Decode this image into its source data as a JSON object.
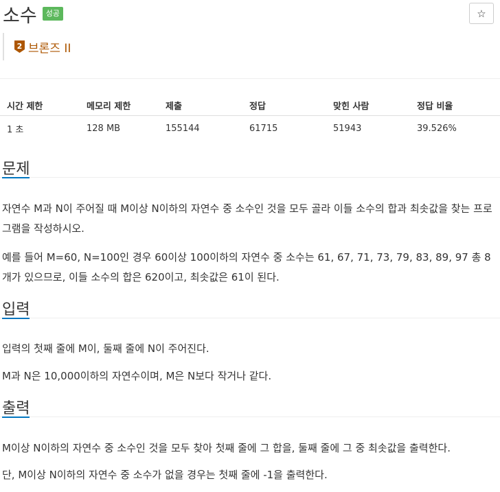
{
  "problem": {
    "title": "소수",
    "result_badge": "성공",
    "tier_number": "2",
    "tier_label": "브론즈 II",
    "star_icon_char": "☆"
  },
  "stats": {
    "headers": [
      "시간 제한",
      "메모리 제한",
      "제출",
      "정답",
      "맞힌 사람",
      "정답 비율"
    ],
    "values": [
      "1 초",
      "128 MB",
      "155144",
      "61715",
      "51943",
      "39.526%"
    ]
  },
  "sections": {
    "description": {
      "title": "문제",
      "paragraphs": [
        "자연수 M과 N이 주어질 때 M이상 N이하의 자연수 중 소수인 것을 모두 골라 이들 소수의 합과 최솟값을 찾는 프로그램을 작성하시오.",
        "예를 들어 M=60, N=100인 경우 60이상 100이하의 자연수 중 소수는 61, 67, 71, 73, 79, 83, 89, 97 총 8개가 있으므로, 이들 소수의 합은 620이고, 최솟값은 61이 된다."
      ]
    },
    "input": {
      "title": "입력",
      "paragraphs": [
        "입력의 첫째 줄에 M이, 둘째 줄에 N이 주어진다.",
        "M과 N은 10,000이하의 자연수이며, M은 N보다 작거나 같다."
      ]
    },
    "output": {
      "title": "출력",
      "paragraphs": [
        "M이상 N이하의 자연수 중 소수인 것을 모두 찾아 첫째 줄에 그 합을, 둘째 줄에 그 중 최솟값을 출력한다.",
        "단, M이상 N이하의 자연수 중 소수가 없을 경우는 첫째 줄에 -1을 출력한다."
      ]
    }
  },
  "colors": {
    "success_badge": "#5cb85c",
    "tier_bronze": "#ad5600",
    "section_accent": "#0076c0"
  }
}
